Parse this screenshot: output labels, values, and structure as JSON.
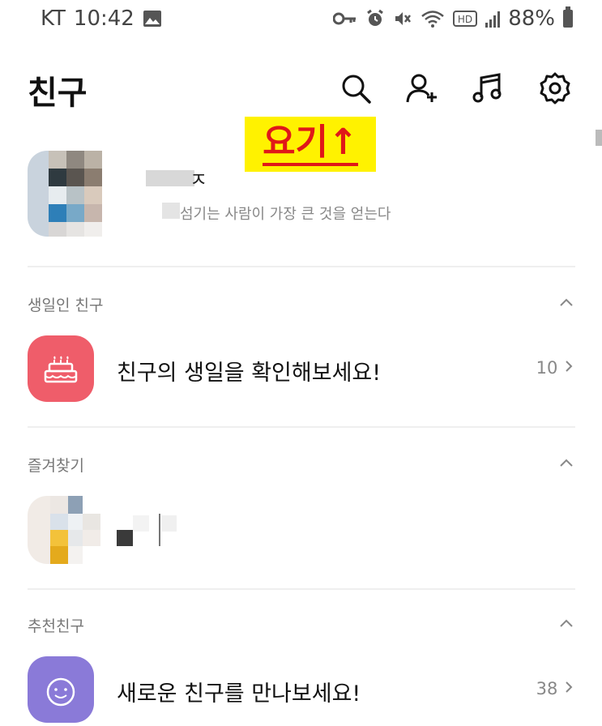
{
  "status_bar": {
    "carrier": "KT",
    "time": "10:42",
    "battery": "88%"
  },
  "header": {
    "title": "친구",
    "icons": [
      "search-icon",
      "add-friend-icon",
      "music-icon",
      "settings-icon"
    ]
  },
  "annotation": {
    "text": "요기↑"
  },
  "profile": {
    "name": "ㅈ",
    "status_message": "섬기는 사람이 가장 큰 것을 얻는다"
  },
  "birthday_section": {
    "title": "생일인 친구",
    "row_text": "친구의 생일을 확인해보세요!",
    "count": "10"
  },
  "favorites_section": {
    "title": "즐겨찾기"
  },
  "recommend_section": {
    "title": "추천친구",
    "row_text": "새로운 친구를 만나보세요!",
    "count": "38"
  },
  "colors": {
    "birthday_icon_bg": "#ef5d6a",
    "recommend_icon_bg": "#8a7ad8",
    "annotation_bg": "#fff200",
    "annotation_text": "#e01818"
  }
}
